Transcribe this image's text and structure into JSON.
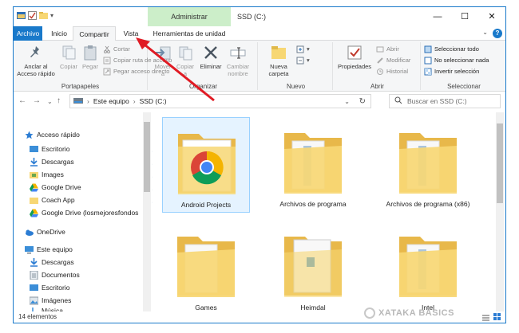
{
  "window": {
    "context_tab": "Administrar",
    "title": "SSD (C:)"
  },
  "tabs": [
    "Archivo",
    "Inicio",
    "Compartir",
    "Vista",
    "Herramientas de unidad"
  ],
  "ribbon": {
    "portapapeles": {
      "pin_label": "Anclar al Acceso rápido",
      "copy_label": "Copiar",
      "paste_label": "Pegar",
      "cut": "Cortar",
      "copy_path": "Copiar ruta de acceso",
      "paste_shortcut": "Pegar acceso directo",
      "group": "Portapapeles"
    },
    "organizar": {
      "move_label": "Mover a",
      "copy_to_label": "Copiar a",
      "delete_label": "Eliminar",
      "rename_label": "Cambiar nombre",
      "group": "Organizar"
    },
    "nuevo": {
      "new_folder_label": "Nueva carpeta",
      "group": "Nuevo"
    },
    "abrir": {
      "properties_label": "Propiedades",
      "open": "Abrir",
      "edit": "Modificar",
      "history": "Historial",
      "group": "Abrir"
    },
    "seleccionar": {
      "select_all": "Seleccionar todo",
      "select_none": "No seleccionar nada",
      "invert": "Invertir selección",
      "group": "Seleccionar"
    }
  },
  "address": {
    "crumbs": [
      "Este equipo",
      "SSD (C:)"
    ],
    "search_placeholder": "Buscar en SSD (C:)"
  },
  "nav": {
    "quick_access": "Acceso rápido",
    "items": [
      "Escritorio",
      "Descargas",
      "Images",
      "Google Drive",
      "Coach App",
      "Google Drive (losmejoresfondos"
    ],
    "onedrive": "OneDrive",
    "this_pc": "Este equipo",
    "pc_items": [
      "Descargas",
      "Documentos",
      "Escritorio",
      "Imágenes",
      "Música"
    ]
  },
  "files": [
    {
      "name": "Android Projects"
    },
    {
      "name": "Archivos de programa"
    },
    {
      "name": "Archivos de programa (x86)"
    },
    {
      "name": "Games"
    },
    {
      "name": "Heimdal"
    },
    {
      "name": "Intel"
    }
  ],
  "status": {
    "count": "14 elementos"
  },
  "watermark": "XATAKA BASICS",
  "colors": {
    "accent": "#1979ca",
    "context_tab": "#cceec9",
    "folder": "#f7d774",
    "arrow": "#e01b24"
  }
}
